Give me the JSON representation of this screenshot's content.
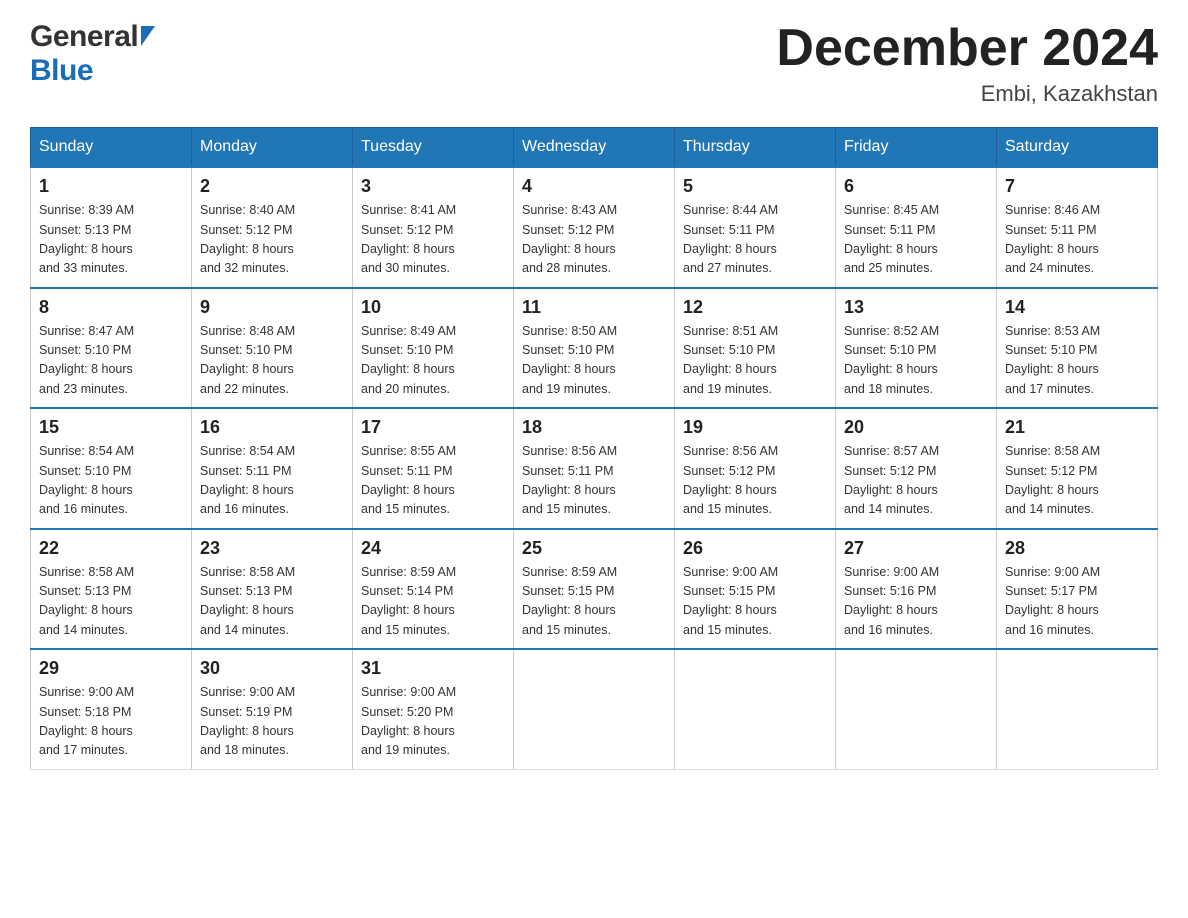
{
  "header": {
    "logo_general": "General",
    "logo_blue": "Blue",
    "month_title": "December 2024",
    "location": "Embi, Kazakhstan"
  },
  "days_of_week": [
    "Sunday",
    "Monday",
    "Tuesday",
    "Wednesday",
    "Thursday",
    "Friday",
    "Saturday"
  ],
  "weeks": [
    [
      {
        "day": "1",
        "info": "Sunrise: 8:39 AM\nSunset: 5:13 PM\nDaylight: 8 hours\nand 33 minutes."
      },
      {
        "day": "2",
        "info": "Sunrise: 8:40 AM\nSunset: 5:12 PM\nDaylight: 8 hours\nand 32 minutes."
      },
      {
        "day": "3",
        "info": "Sunrise: 8:41 AM\nSunset: 5:12 PM\nDaylight: 8 hours\nand 30 minutes."
      },
      {
        "day": "4",
        "info": "Sunrise: 8:43 AM\nSunset: 5:12 PM\nDaylight: 8 hours\nand 28 minutes."
      },
      {
        "day": "5",
        "info": "Sunrise: 8:44 AM\nSunset: 5:11 PM\nDaylight: 8 hours\nand 27 minutes."
      },
      {
        "day": "6",
        "info": "Sunrise: 8:45 AM\nSunset: 5:11 PM\nDaylight: 8 hours\nand 25 minutes."
      },
      {
        "day": "7",
        "info": "Sunrise: 8:46 AM\nSunset: 5:11 PM\nDaylight: 8 hours\nand 24 minutes."
      }
    ],
    [
      {
        "day": "8",
        "info": "Sunrise: 8:47 AM\nSunset: 5:10 PM\nDaylight: 8 hours\nand 23 minutes."
      },
      {
        "day": "9",
        "info": "Sunrise: 8:48 AM\nSunset: 5:10 PM\nDaylight: 8 hours\nand 22 minutes."
      },
      {
        "day": "10",
        "info": "Sunrise: 8:49 AM\nSunset: 5:10 PM\nDaylight: 8 hours\nand 20 minutes."
      },
      {
        "day": "11",
        "info": "Sunrise: 8:50 AM\nSunset: 5:10 PM\nDaylight: 8 hours\nand 19 minutes."
      },
      {
        "day": "12",
        "info": "Sunrise: 8:51 AM\nSunset: 5:10 PM\nDaylight: 8 hours\nand 19 minutes."
      },
      {
        "day": "13",
        "info": "Sunrise: 8:52 AM\nSunset: 5:10 PM\nDaylight: 8 hours\nand 18 minutes."
      },
      {
        "day": "14",
        "info": "Sunrise: 8:53 AM\nSunset: 5:10 PM\nDaylight: 8 hours\nand 17 minutes."
      }
    ],
    [
      {
        "day": "15",
        "info": "Sunrise: 8:54 AM\nSunset: 5:10 PM\nDaylight: 8 hours\nand 16 minutes."
      },
      {
        "day": "16",
        "info": "Sunrise: 8:54 AM\nSunset: 5:11 PM\nDaylight: 8 hours\nand 16 minutes."
      },
      {
        "day": "17",
        "info": "Sunrise: 8:55 AM\nSunset: 5:11 PM\nDaylight: 8 hours\nand 15 minutes."
      },
      {
        "day": "18",
        "info": "Sunrise: 8:56 AM\nSunset: 5:11 PM\nDaylight: 8 hours\nand 15 minutes."
      },
      {
        "day": "19",
        "info": "Sunrise: 8:56 AM\nSunset: 5:12 PM\nDaylight: 8 hours\nand 15 minutes."
      },
      {
        "day": "20",
        "info": "Sunrise: 8:57 AM\nSunset: 5:12 PM\nDaylight: 8 hours\nand 14 minutes."
      },
      {
        "day": "21",
        "info": "Sunrise: 8:58 AM\nSunset: 5:12 PM\nDaylight: 8 hours\nand 14 minutes."
      }
    ],
    [
      {
        "day": "22",
        "info": "Sunrise: 8:58 AM\nSunset: 5:13 PM\nDaylight: 8 hours\nand 14 minutes."
      },
      {
        "day": "23",
        "info": "Sunrise: 8:58 AM\nSunset: 5:13 PM\nDaylight: 8 hours\nand 14 minutes."
      },
      {
        "day": "24",
        "info": "Sunrise: 8:59 AM\nSunset: 5:14 PM\nDaylight: 8 hours\nand 15 minutes."
      },
      {
        "day": "25",
        "info": "Sunrise: 8:59 AM\nSunset: 5:15 PM\nDaylight: 8 hours\nand 15 minutes."
      },
      {
        "day": "26",
        "info": "Sunrise: 9:00 AM\nSunset: 5:15 PM\nDaylight: 8 hours\nand 15 minutes."
      },
      {
        "day": "27",
        "info": "Sunrise: 9:00 AM\nSunset: 5:16 PM\nDaylight: 8 hours\nand 16 minutes."
      },
      {
        "day": "28",
        "info": "Sunrise: 9:00 AM\nSunset: 5:17 PM\nDaylight: 8 hours\nand 16 minutes."
      }
    ],
    [
      {
        "day": "29",
        "info": "Sunrise: 9:00 AM\nSunset: 5:18 PM\nDaylight: 8 hours\nand 17 minutes."
      },
      {
        "day": "30",
        "info": "Sunrise: 9:00 AM\nSunset: 5:19 PM\nDaylight: 8 hours\nand 18 minutes."
      },
      {
        "day": "31",
        "info": "Sunrise: 9:00 AM\nSunset: 5:20 PM\nDaylight: 8 hours\nand 19 minutes."
      },
      {
        "day": "",
        "info": ""
      },
      {
        "day": "",
        "info": ""
      },
      {
        "day": "",
        "info": ""
      },
      {
        "day": "",
        "info": ""
      }
    ]
  ]
}
